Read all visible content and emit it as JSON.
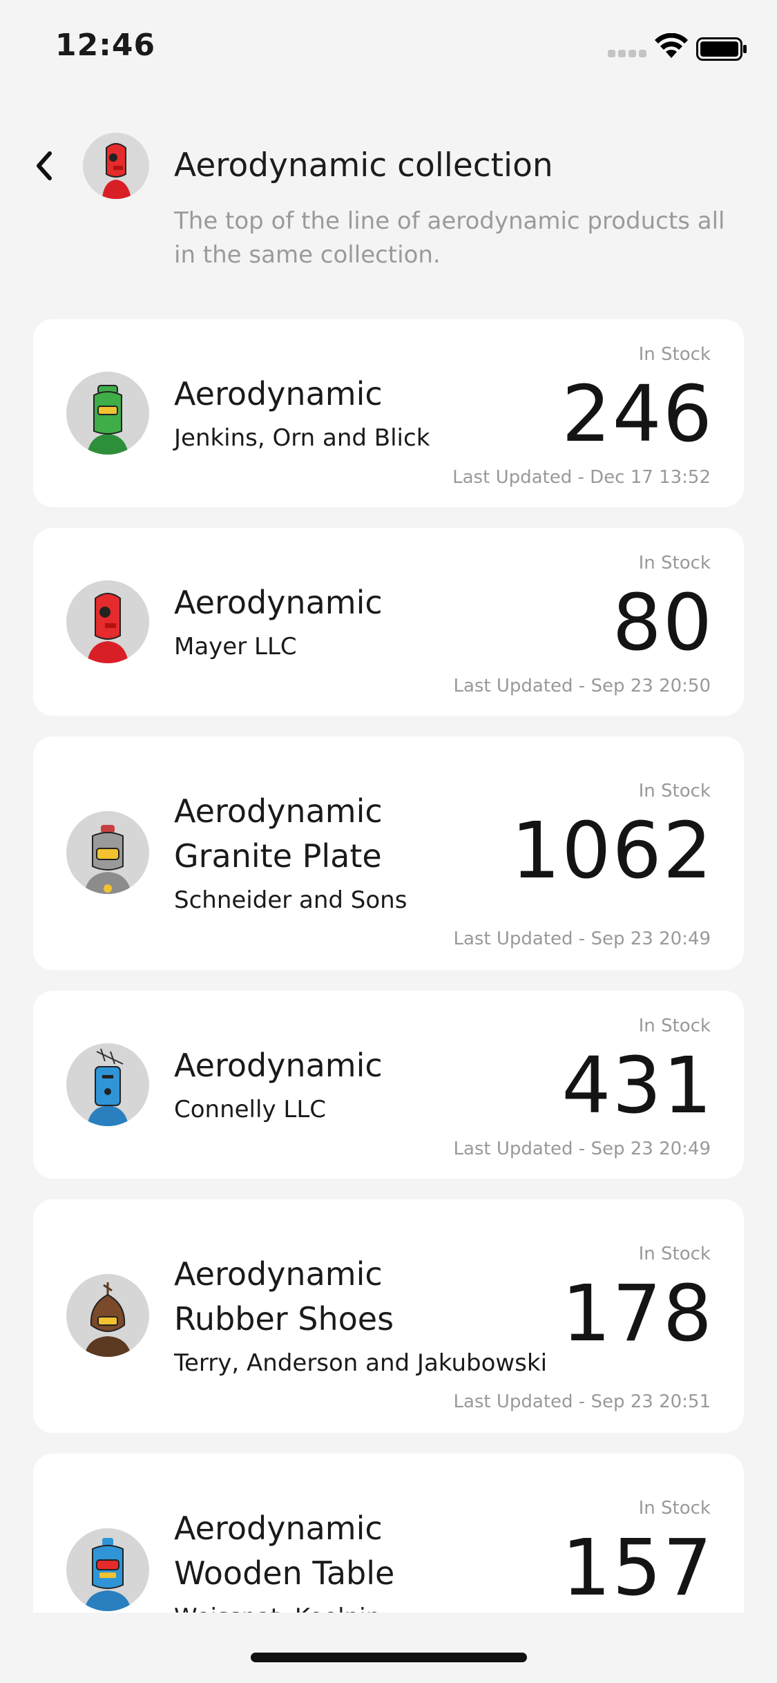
{
  "status_bar": {
    "time": "12:46"
  },
  "header": {
    "title": "Aerodynamic collection",
    "description": "The top of the line of aerodynamic products all in the same collection."
  },
  "items": [
    {
      "name_line1": "Aerodynamic",
      "name_line2": "",
      "company": "Jenkins, Orn and Blick",
      "stock_label": "In Stock",
      "count": "246",
      "updated": "Last Updated - Dec 17 13:52",
      "avatar_color": "#3fae49"
    },
    {
      "name_line1": "Aerodynamic",
      "name_line2": "",
      "company": "Mayer LLC",
      "stock_label": "In Stock",
      "count": "80",
      "updated": "Last Updated - Sep 23 20:50",
      "avatar_color": "#e52b2b"
    },
    {
      "name_line1": "Aerodynamic",
      "name_line2": "Granite Plate",
      "company": "Schneider and Sons",
      "stock_label": "In Stock",
      "count": "1062",
      "updated": "Last Updated - Sep 23 20:49",
      "avatar_color": "#9a9a9a"
    },
    {
      "name_line1": "Aerodynamic",
      "name_line2": "",
      "company": "Connelly LLC",
      "stock_label": "In Stock",
      "count": "431",
      "updated": "Last Updated - Sep 23 20:49",
      "avatar_color": "#2f95d6"
    },
    {
      "name_line1": "Aerodynamic",
      "name_line2": "Rubber Shoes",
      "company": "Terry, Anderson and Jakubowski",
      "stock_label": "In Stock",
      "count": "178",
      "updated": "Last Updated - Sep 23 20:51",
      "avatar_color": "#7a4a2a"
    },
    {
      "name_line1": "Aerodynamic",
      "name_line2": "Wooden Table",
      "company": "Weissnat, Koelpin",
      "stock_label": "In Stock",
      "count": "157",
      "updated": "",
      "avatar_color": "#2f95d6"
    }
  ]
}
